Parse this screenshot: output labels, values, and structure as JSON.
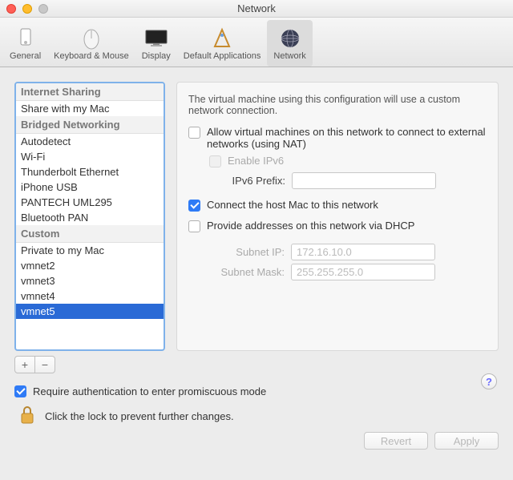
{
  "window": {
    "title": "Network"
  },
  "toolbar": {
    "items": [
      {
        "label": "General"
      },
      {
        "label": "Keyboard & Mouse"
      },
      {
        "label": "Display"
      },
      {
        "label": "Default Applications"
      },
      {
        "label": "Network"
      }
    ],
    "selected_index": 4
  },
  "sidebar": {
    "sections": [
      {
        "header": "Internet Sharing",
        "items": [
          "Share with my Mac"
        ]
      },
      {
        "header": "Bridged Networking",
        "items": [
          "Autodetect",
          "Wi-Fi",
          "Thunderbolt Ethernet",
          "iPhone USB",
          "PANTECH UML295",
          "Bluetooth PAN"
        ]
      },
      {
        "header": "Custom",
        "items": [
          "Private to my Mac",
          "vmnet2",
          "vmnet3",
          "vmnet4",
          "vmnet5"
        ]
      }
    ],
    "selected": "vmnet5"
  },
  "panel": {
    "description": "The virtual machine using this configuration will use a custom network connection.",
    "allow_nat_label": "Allow virtual machines on this network to connect to external networks (using NAT)",
    "allow_nat_checked": false,
    "enable_ipv6_label": "Enable IPv6",
    "enable_ipv6_checked": false,
    "ipv6_prefix_label": "IPv6 Prefix:",
    "ipv6_prefix_value": "",
    "connect_host_label": "Connect the host Mac to this network",
    "connect_host_checked": true,
    "dhcp_label": "Provide addresses on this network via DHCP",
    "dhcp_checked": false,
    "subnet_ip_label": "Subnet IP:",
    "subnet_ip_value": "172.16.10.0",
    "subnet_mask_label": "Subnet Mask:",
    "subnet_mask_value": "255.255.255.0"
  },
  "footer": {
    "auth_label": "Require authentication to enter promiscuous mode",
    "auth_checked": true,
    "lock_label": "Click the lock to prevent further changes.",
    "revert_label": "Revert",
    "apply_label": "Apply"
  },
  "buttons": {
    "add": "+",
    "remove": "−",
    "help": "?"
  }
}
